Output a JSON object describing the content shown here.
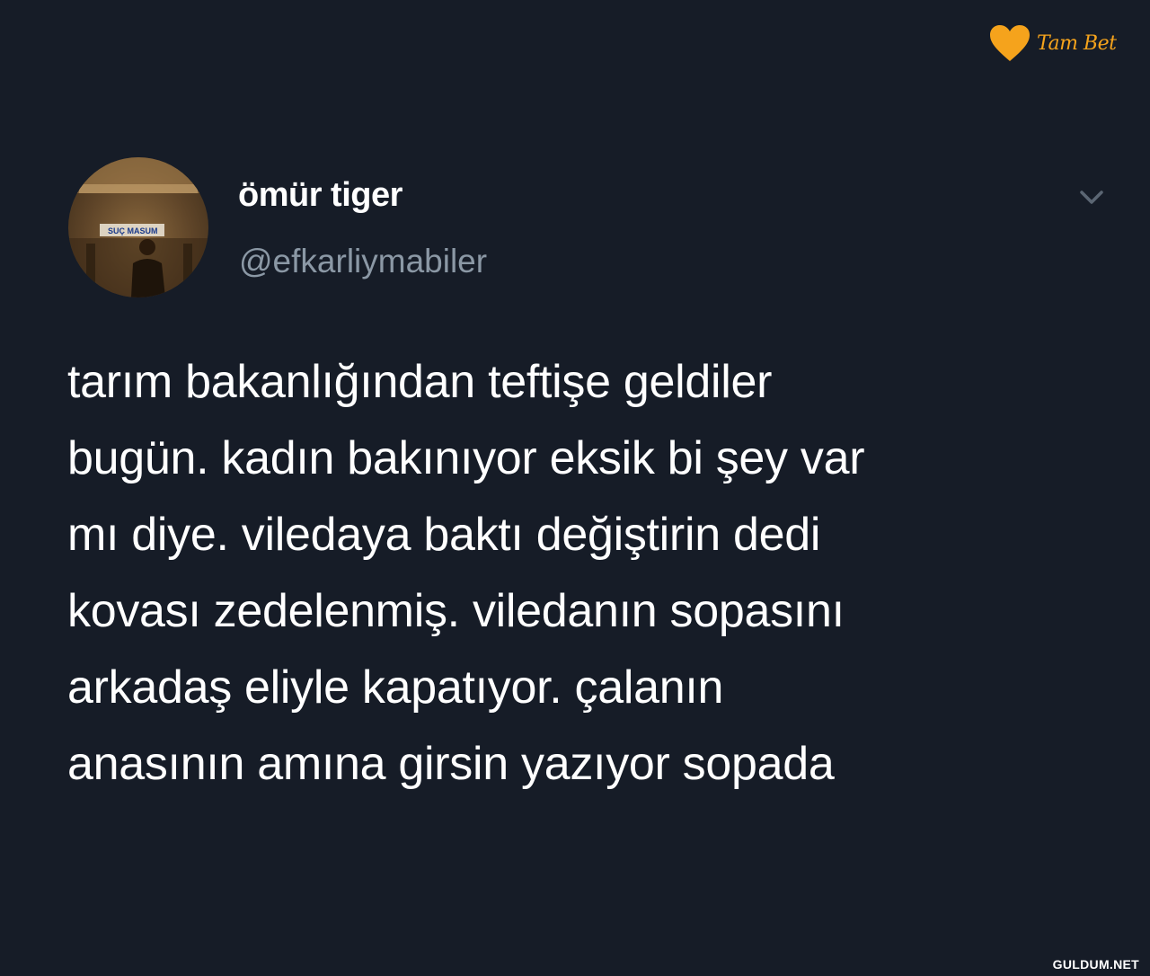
{
  "brand": {
    "logo_text": "Tam Bet",
    "accent_color": "#f5a31c",
    "icon": "heart-icon"
  },
  "tweet": {
    "author": {
      "display_name": "ömür tiger",
      "handle": "@efkarliymabiler",
      "avatar_sign_text": "SUÇ MASUM"
    },
    "menu_icon": "chevron-down-icon",
    "text_lines": [
      "tarım bakanlığından teftişe geldiler",
      "bugün. kadın bakınıyor eksik bi şey var",
      "mı diye. viledaya baktı değiştirin dedi",
      "kovası zedelenmiş. viledanın sopasını",
      "arkadaş eliyle kapatıyor. çalanın",
      "anasının amına girsin yazıyor sopada"
    ]
  },
  "watermark": {
    "site": "GULDUM.NET"
  },
  "colors": {
    "background": "#161c27",
    "text_primary": "#ffffff",
    "text_secondary": "#8b98a5"
  }
}
